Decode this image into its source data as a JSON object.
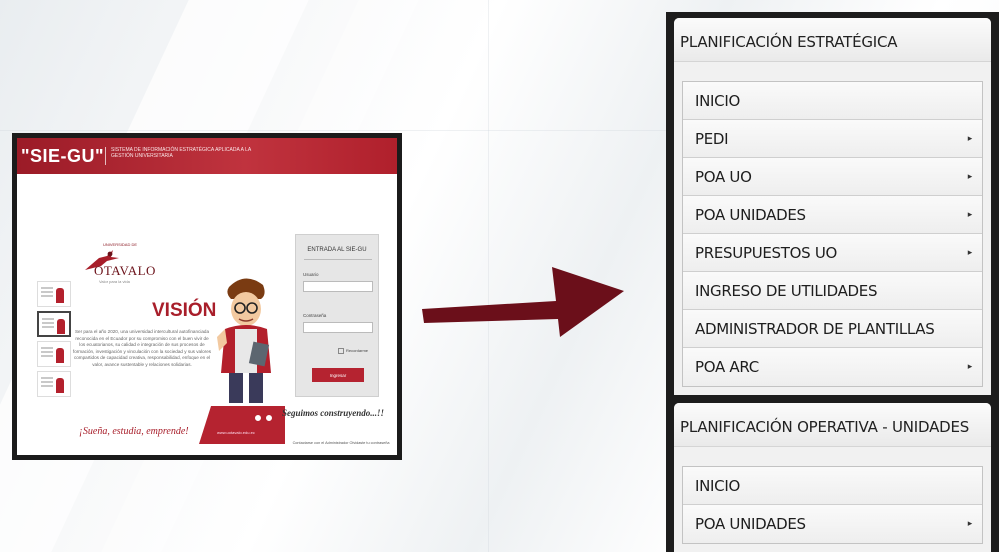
{
  "left_screenshot": {
    "brand": "\"SIE-GU\"",
    "brand_subtitle": "SISTEMA DE INFORMACIÓN ESTRATÉGICA APLICADA A LA GESTIÓN UNIVERSITARIA",
    "university_small": "UNIVERSIDAD DE",
    "university_name": "OTAVALO",
    "university_tagline": "Valor para la vida",
    "vision_title": "VISIÓN",
    "vision_text": "Ser para el año 2020, una universidad intercultural autofinanciada reconocida en el Ecuador por su compromiso con el buen vivir de los ecuatorianos, su calidad e integración de sus procesos de formación, investigación y vinculación con la sociedad y sus valores compartidos de capacidad creativa, responsabilidad, enfoque en el valor, avance sustentable y relaciones solidarias.",
    "slogan": "¡Sueña, estudia, emprende!",
    "website": "www.uotavalo.edu.ec",
    "continuing": "Seguimos construyendo...!!",
    "login": {
      "title": "ENTRADA AL SIE-GU",
      "user_label": "Usuario",
      "user_value": "",
      "password_label": "Contraseña",
      "password_value": "",
      "remember_label": "Recordarme",
      "submit_label": "Ingresar"
    },
    "contact_text": "Contactarse con el Administrador Olvidaste tu contraseña"
  },
  "arrow_color": "#6b0f1a",
  "menu": {
    "strategic": {
      "title": "PLANIFICACIÓN ESTRATÉGICA",
      "items": [
        {
          "label": "INICIO",
          "submenu": false
        },
        {
          "label": "PEDI",
          "submenu": true
        },
        {
          "label": "POA UO",
          "submenu": true
        },
        {
          "label": "POA UNIDADES",
          "submenu": true
        },
        {
          "label": "PRESUPUESTOS UO",
          "submenu": true
        },
        {
          "label": "INGRESO DE UTILIDADES",
          "submenu": false
        },
        {
          "label": "ADMINISTRADOR DE PLANTILLAS",
          "submenu": false
        },
        {
          "label": "POA ARC",
          "submenu": true
        }
      ]
    },
    "operational": {
      "title": "PLANIFICACIÓN OPERATIVA - UNIDADES",
      "items": [
        {
          "label": "INICIO",
          "submenu": false
        },
        {
          "label": "POA UNIDADES",
          "submenu": true
        }
      ]
    },
    "caret_glyph": "▸"
  }
}
